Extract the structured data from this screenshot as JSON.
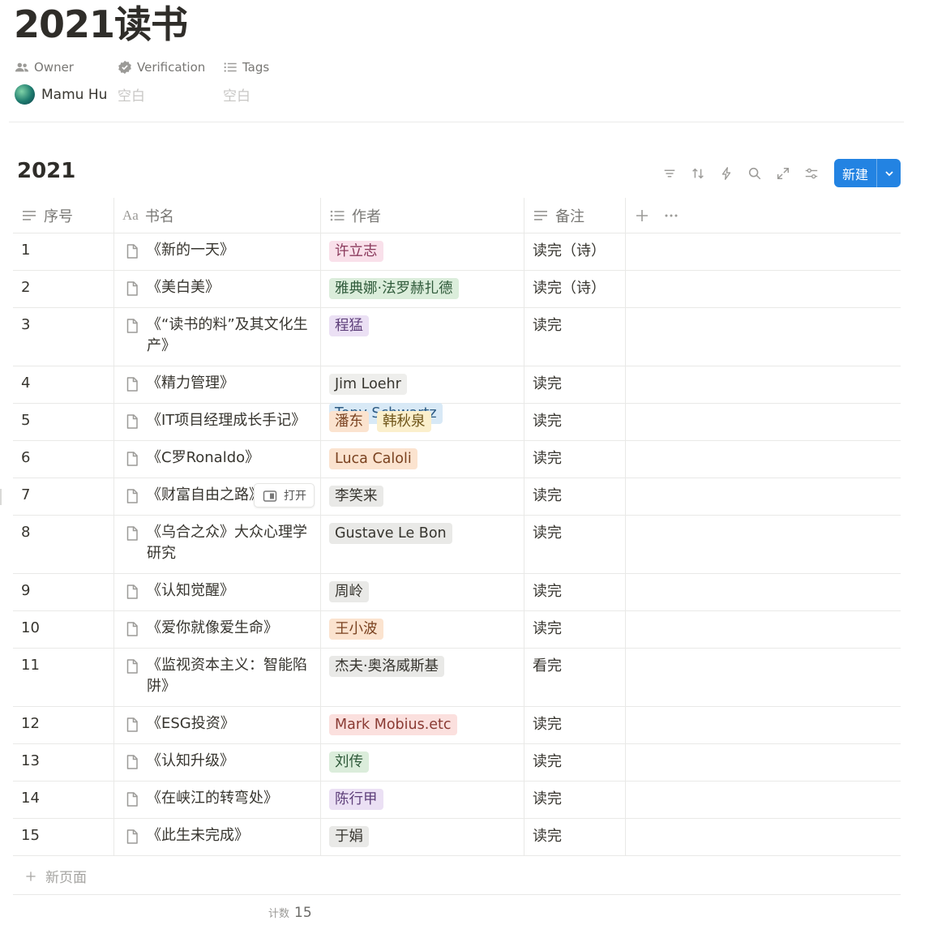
{
  "page": {
    "title": "2021读书"
  },
  "properties": {
    "owner_label": "Owner",
    "verification_label": "Verification",
    "tags_label": "Tags",
    "owner_value": "Mamu Hu",
    "verification_value": "空白",
    "tags_value": "空白"
  },
  "database": {
    "title": "2021",
    "new_button": "新建",
    "columns": [
      "序号",
      "书名",
      "作者",
      "备注"
    ],
    "open_button": "打开",
    "rows": [
      {
        "no": "1",
        "book": "《新的一天》",
        "authors": [
          {
            "name": "许立志",
            "bg": "#f9e0ea",
            "fg": "#8a3a5c"
          }
        ],
        "note": "读完（诗）"
      },
      {
        "no": "2",
        "book": "《美白美》",
        "authors": [
          {
            "name": "雅典娜·法罗赫扎德",
            "bg": "#dbeddb",
            "fg": "#2f5a3a"
          }
        ],
        "note": "读完（诗）"
      },
      {
        "no": "3",
        "book": "《“读书的料”及其文化生产》",
        "authors": [
          {
            "name": "程猛",
            "bg": "#ebe0f4",
            "fg": "#5e3f7a"
          }
        ],
        "note": "读完"
      },
      {
        "no": "4",
        "book": "《精力管理》",
        "authors": [
          {
            "name": "Jim Loehr",
            "bg": "#eeeeec",
            "fg": "#37352f"
          },
          {
            "name": "Tony Schwartz",
            "bg": "#d8e9f6",
            "fg": "#2b5a82"
          }
        ],
        "note": "读完"
      },
      {
        "no": "5",
        "book": "《IT项目经理成长手记》",
        "authors": [
          {
            "name": "潘东",
            "bg": "#fbe3cf",
            "fg": "#7a4220"
          },
          {
            "name": "韩秋泉",
            "bg": "#fbefcc",
            "fg": "#6e5418"
          }
        ],
        "note": "读完"
      },
      {
        "no": "6",
        "book": "《C罗Ronaldo》",
        "authors": [
          {
            "name": "Luca Caloli",
            "bg": "#fbe3cf",
            "fg": "#7a4220"
          }
        ],
        "note": "读完"
      },
      {
        "no": "7",
        "book": "《财富自由之路》",
        "authors": [
          {
            "name": "李笑来",
            "bg": "#e9e9e7",
            "fg": "#37352f"
          }
        ],
        "note": "读完"
      },
      {
        "no": "8",
        "book": "《乌合之众》大众心理学研究",
        "authors": [
          {
            "name": "Gustave Le Bon",
            "bg": "#e9e9e7",
            "fg": "#37352f"
          }
        ],
        "note": "读完"
      },
      {
        "no": "9",
        "book": "《认知觉醒》",
        "authors": [
          {
            "name": "周岭",
            "bg": "#e9e9e7",
            "fg": "#37352f"
          }
        ],
        "note": "读完"
      },
      {
        "no": "10",
        "book": "《爱你就像爱生命》",
        "authors": [
          {
            "name": "王小波",
            "bg": "#fbe3cf",
            "fg": "#7a4220"
          }
        ],
        "note": "读完"
      },
      {
        "no": "11",
        "book": "《监视资本主义：智能陷阱》",
        "authors": [
          {
            "name": "杰夫·奥洛威斯基",
            "bg": "#e9e9e7",
            "fg": "#37352f"
          }
        ],
        "note": "看完"
      },
      {
        "no": "12",
        "book": "《ESG投资》",
        "authors": [
          {
            "name": "Mark Mobius.etc",
            "bg": "#fbe0de",
            "fg": "#8a3a33"
          }
        ],
        "note": "读完"
      },
      {
        "no": "13",
        "book": "《认知升级》",
        "authors": [
          {
            "name": "刘传",
            "bg": "#dbeddb",
            "fg": "#2f5a3a"
          }
        ],
        "note": "读完"
      },
      {
        "no": "14",
        "book": "《在峡江的转弯处》",
        "authors": [
          {
            "name": "陈行甲",
            "bg": "#ebe0f4",
            "fg": "#5e3f7a"
          }
        ],
        "note": "读完"
      },
      {
        "no": "15",
        "book": "《此生未完成》",
        "authors": [
          {
            "name": "于娟",
            "bg": "#e9e9e7",
            "fg": "#37352f"
          }
        ],
        "note": "读完"
      }
    ],
    "new_page": "新页面",
    "count_label": "计数",
    "count_value": "15"
  }
}
